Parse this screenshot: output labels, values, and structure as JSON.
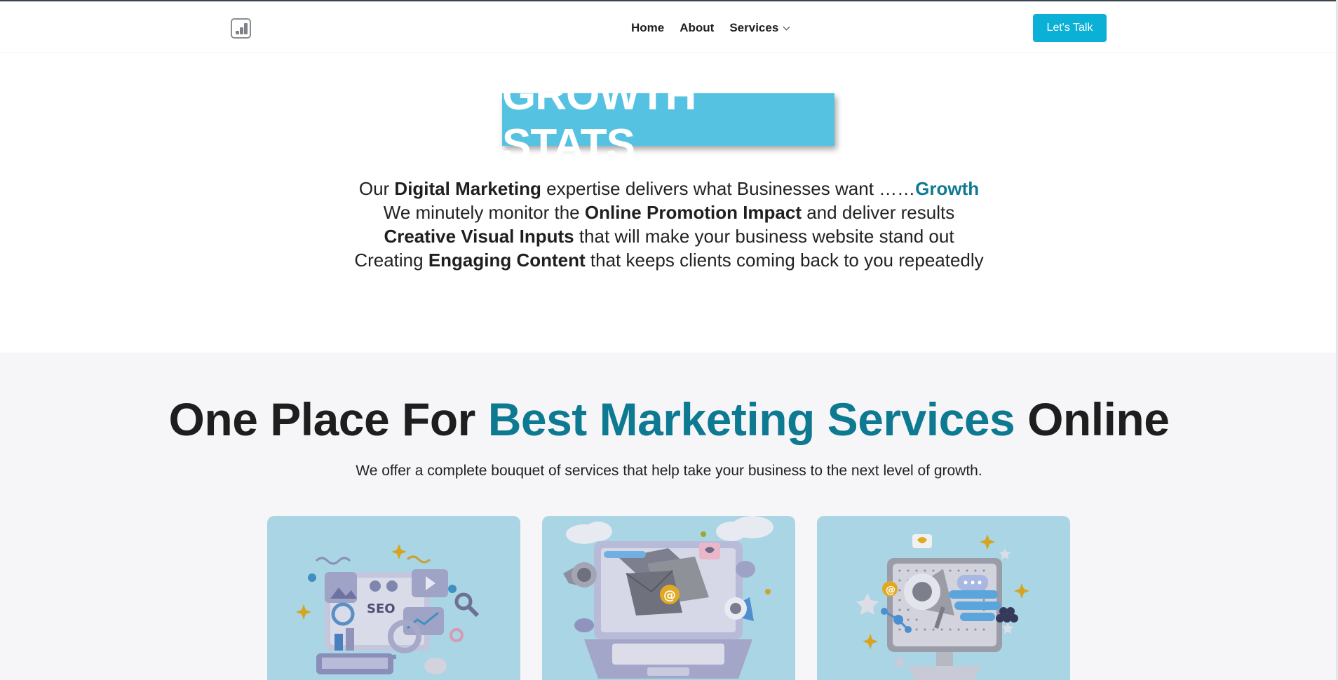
{
  "header": {
    "logo_icon": "bar-chart-icon",
    "nav": [
      {
        "label": "Home"
      },
      {
        "label": "About"
      },
      {
        "label": "Services"
      }
    ],
    "cta_label": "Let's Talk"
  },
  "hero": {
    "title": "GROWTH STATS",
    "line1": {
      "a": "Our ",
      "b": "Digital Marketing",
      "c": " expertise delivers what Businesses want ……",
      "d": "Growth"
    },
    "line2": {
      "a": "We minutely monitor the ",
      "b": "Online Promotion Impact",
      "c": " and deliver results"
    },
    "line3": {
      "b": "Creative Visual Inputs",
      "c": " that will make your business website stand out"
    },
    "line4": {
      "a": "Creating ",
      "b": "Engaging Content",
      "c": " that keeps clients coming back to you repeatedly"
    }
  },
  "services": {
    "title_a": "One Place For ",
    "title_accent": "Best Marketing Services",
    "title_b": " Online",
    "subtitle": "We offer a complete bouquet of services that help take your business to the next level of growth.",
    "cards": [
      {
        "illustration": "seo-dashboard-illustration",
        "text": "SEO"
      },
      {
        "illustration": "email-marketing-laptop-illustration",
        "text": "@"
      },
      {
        "illustration": "social-promotion-monitor-illustration",
        "text": ""
      }
    ]
  },
  "colors": {
    "accent": "#0e7a92",
    "cta": "#0ab0d6",
    "hero_box": "#56c2e1",
    "card_bg": "#a9d5e4",
    "section_bg": "#f6f6f8"
  }
}
